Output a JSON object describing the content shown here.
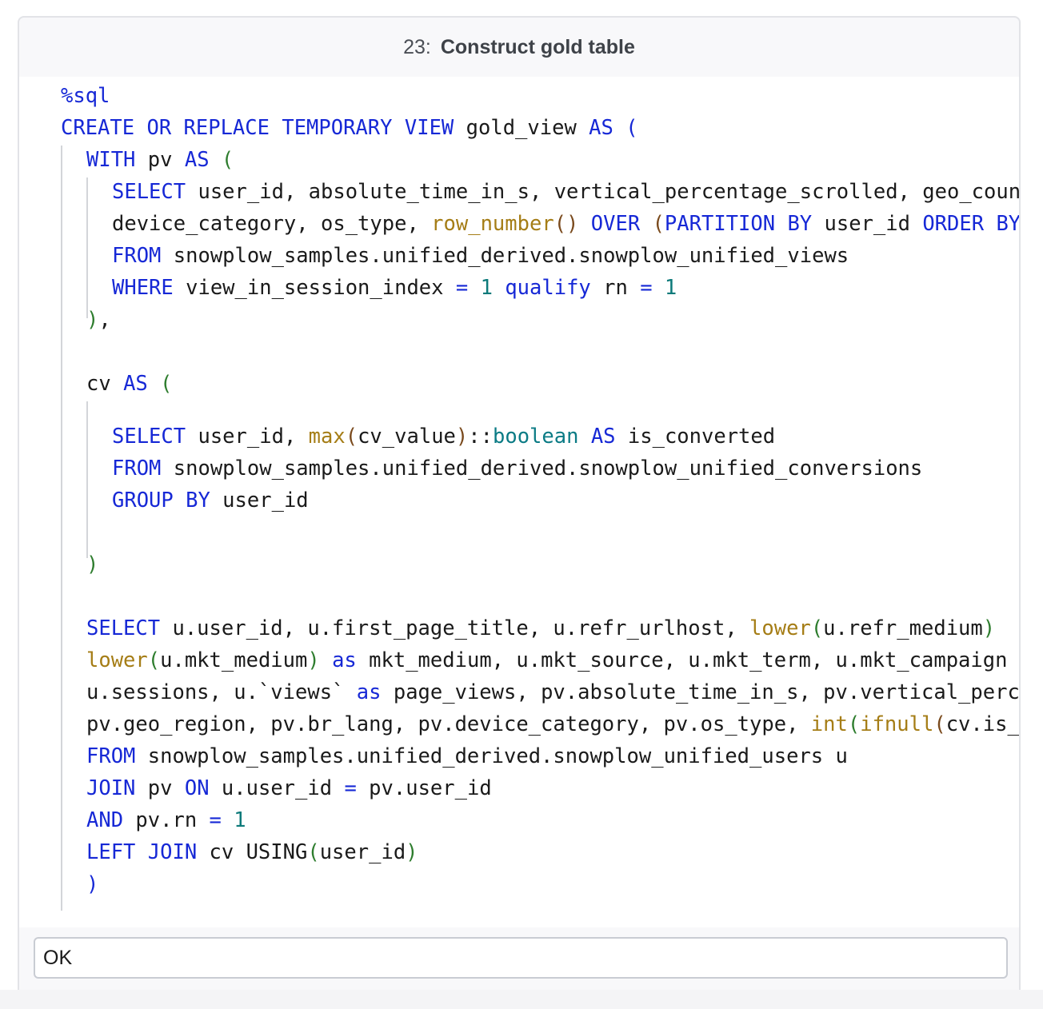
{
  "cell": {
    "number": "23:",
    "title": "Construct gold table"
  },
  "output": {
    "status": "OK"
  },
  "code": {
    "lines": [
      [
        {
          "t": "%sql",
          "c": "kw"
        }
      ],
      [
        {
          "t": "CREATE OR REPLACE TEMPORARY VIEW",
          "c": "kw"
        },
        {
          "t": " gold_view ",
          "c": "id"
        },
        {
          "t": "AS",
          "c": "kw"
        },
        {
          "t": " ",
          "c": "id"
        },
        {
          "t": "(",
          "c": "paren-bl"
        }
      ],
      [
        {
          "t": "WITH",
          "c": "kw"
        },
        {
          "t": " pv ",
          "c": "id"
        },
        {
          "t": "AS",
          "c": "kw"
        },
        {
          "t": " ",
          "c": "id"
        },
        {
          "t": "(",
          "c": "paren-g"
        }
      ],
      [
        {
          "t": "SELECT",
          "c": "kw"
        },
        {
          "t": " user_id, absolute_time_in_s, vertical_percentage_scrolled, geo_country",
          "c": "id"
        }
      ],
      [
        {
          "t": "device_category, os_type, ",
          "c": "id"
        },
        {
          "t": "row_number",
          "c": "fn"
        },
        {
          "t": "()",
          "c": "paren-b"
        },
        {
          "t": " ",
          "c": "id"
        },
        {
          "t": "OVER",
          "c": "kw"
        },
        {
          "t": " ",
          "c": "id"
        },
        {
          "t": "(",
          "c": "paren-b"
        },
        {
          "t": "PARTITION BY",
          "c": "kw"
        },
        {
          "t": " user_id ",
          "c": "id"
        },
        {
          "t": "ORDER BY",
          "c": "kw"
        }
      ],
      [
        {
          "t": "FROM",
          "c": "kw"
        },
        {
          "t": " snowplow_samples.unified_derived.snowplow_unified_views",
          "c": "id"
        }
      ],
      [
        {
          "t": "WHERE",
          "c": "kw"
        },
        {
          "t": " view_in_session_index ",
          "c": "id"
        },
        {
          "t": "=",
          "c": "kw"
        },
        {
          "t": " ",
          "c": "id"
        },
        {
          "t": "1",
          "c": "num"
        },
        {
          "t": " ",
          "c": "id"
        },
        {
          "t": "qualify",
          "c": "kw"
        },
        {
          "t": " rn ",
          "c": "id"
        },
        {
          "t": "=",
          "c": "kw"
        },
        {
          "t": " ",
          "c": "id"
        },
        {
          "t": "1",
          "c": "num"
        }
      ],
      [
        {
          "t": ")",
          "c": "paren-g"
        },
        {
          "t": ",",
          "c": "id"
        }
      ],
      [],
      [
        {
          "t": "cv ",
          "c": "id"
        },
        {
          "t": "AS",
          "c": "kw"
        },
        {
          "t": " ",
          "c": "id"
        },
        {
          "t": "(",
          "c": "paren-g"
        }
      ],
      [],
      [
        {
          "t": "SELECT",
          "c": "kw"
        },
        {
          "t": " user_id, ",
          "c": "id"
        },
        {
          "t": "max",
          "c": "fn"
        },
        {
          "t": "(",
          "c": "paren-b"
        },
        {
          "t": "cv_value",
          "c": "id"
        },
        {
          "t": ")",
          "c": "paren-b"
        },
        {
          "t": "::",
          "c": "id"
        },
        {
          "t": "boolean",
          "c": "type"
        },
        {
          "t": " ",
          "c": "id"
        },
        {
          "t": "AS",
          "c": "kw"
        },
        {
          "t": " is_converted",
          "c": "id"
        }
      ],
      [
        {
          "t": "FROM",
          "c": "kw"
        },
        {
          "t": " snowplow_samples.unified_derived.snowplow_unified_conversions",
          "c": "id"
        }
      ],
      [
        {
          "t": "GROUP BY",
          "c": "kw"
        },
        {
          "t": " user_id",
          "c": "id"
        }
      ],
      [],
      [
        {
          "t": ")",
          "c": "paren-g"
        }
      ],
      [],
      [
        {
          "t": "SELECT",
          "c": "kw"
        },
        {
          "t": " u.user_id, u.first_page_title, u.refr_urlhost, ",
          "c": "id"
        },
        {
          "t": "lower",
          "c": "fn"
        },
        {
          "t": "(",
          "c": "paren-g"
        },
        {
          "t": "u.refr_medium",
          "c": "id"
        },
        {
          "t": ")",
          "c": "paren-g"
        }
      ],
      [
        {
          "t": "lower",
          "c": "fn"
        },
        {
          "t": "(",
          "c": "paren-g"
        },
        {
          "t": "u.mkt_medium",
          "c": "id"
        },
        {
          "t": ")",
          "c": "paren-g"
        },
        {
          "t": " ",
          "c": "id"
        },
        {
          "t": "as",
          "c": "kw"
        },
        {
          "t": " mkt_medium, u.mkt_source, u.mkt_term, u.mkt_campaign",
          "c": "id"
        }
      ],
      [
        {
          "t": "u.sessions, u.`views` ",
          "c": "id"
        },
        {
          "t": "as",
          "c": "kw"
        },
        {
          "t": " page_views, pv.absolute_time_in_s, pv.vertical_percentage",
          "c": "id"
        }
      ],
      [
        {
          "t": "pv.geo_region, pv.br_lang, pv.device_category, pv.os_type, ",
          "c": "id"
        },
        {
          "t": "int",
          "c": "fn"
        },
        {
          "t": "(",
          "c": "paren-g"
        },
        {
          "t": "ifnull",
          "c": "fn"
        },
        {
          "t": "(",
          "c": "paren-b"
        },
        {
          "t": "cv.is_converted",
          "c": "id"
        }
      ],
      [
        {
          "t": "FROM",
          "c": "kw"
        },
        {
          "t": " snowplow_samples.unified_derived.snowplow_unified_users u",
          "c": "id"
        }
      ],
      [
        {
          "t": "JOIN",
          "c": "kw"
        },
        {
          "t": " pv ",
          "c": "id"
        },
        {
          "t": "ON",
          "c": "kw"
        },
        {
          "t": " u.user_id ",
          "c": "id"
        },
        {
          "t": "=",
          "c": "kw"
        },
        {
          "t": " pv.user_id",
          "c": "id"
        }
      ],
      [
        {
          "t": "AND",
          "c": "kw"
        },
        {
          "t": " pv.rn ",
          "c": "id"
        },
        {
          "t": "=",
          "c": "kw"
        },
        {
          "t": " ",
          "c": "id"
        },
        {
          "t": "1",
          "c": "num"
        }
      ],
      [
        {
          "t": "LEFT JOIN",
          "c": "kw"
        },
        {
          "t": " cv USING",
          "c": "id"
        },
        {
          "t": "(",
          "c": "paren-g"
        },
        {
          "t": "user_id",
          "c": "id"
        },
        {
          "t": ")",
          "c": "paren-g"
        }
      ],
      [
        {
          "t": ")",
          "c": "paren-bl"
        }
      ]
    ]
  }
}
